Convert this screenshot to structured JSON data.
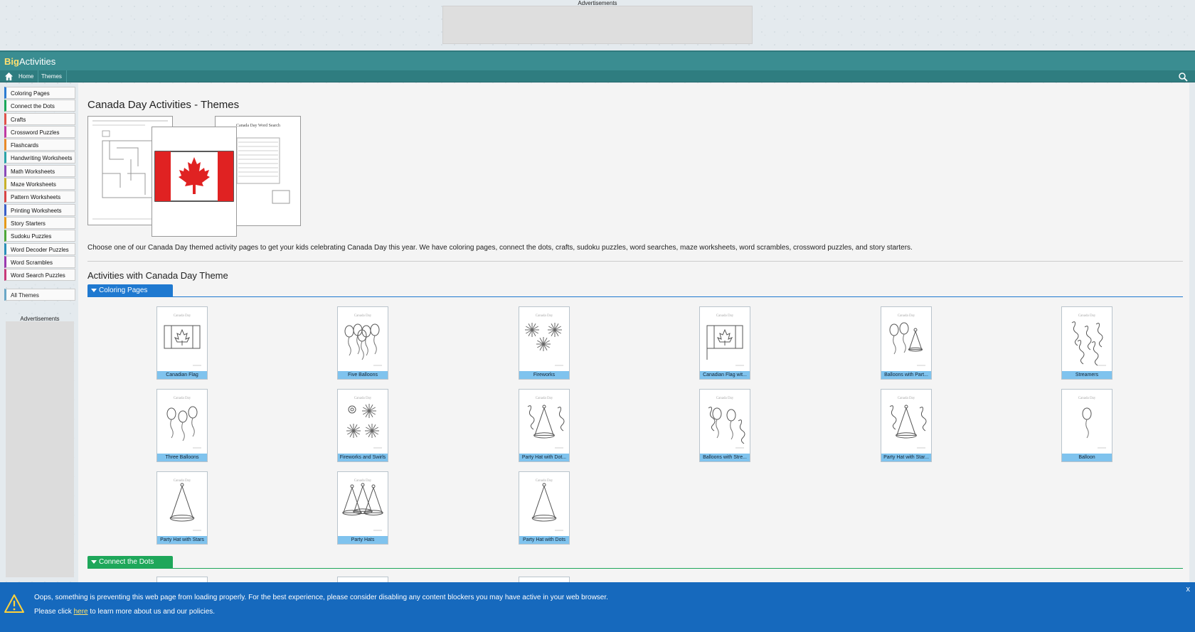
{
  "top_ad": {
    "label": "Advertisements"
  },
  "header": {
    "logo_big": "Big",
    "logo_rest": "Activities"
  },
  "nav": {
    "home": "Home",
    "themes": "Themes"
  },
  "sidebar": {
    "items": [
      {
        "label": "Coloring Pages",
        "color": "#2b7bd1"
      },
      {
        "label": "Connect the Dots",
        "color": "#1aa85a"
      },
      {
        "label": "Crafts",
        "color": "#e0524a"
      },
      {
        "label": "Crossword Puzzles",
        "color": "#c03aa3"
      },
      {
        "label": "Flashcards",
        "color": "#e88a2a"
      },
      {
        "label": "Handwriting Worksheets",
        "color": "#2aa4a8"
      },
      {
        "label": "Math Worksheets",
        "color": "#8a4ab8"
      },
      {
        "label": "Maze Worksheets",
        "color": "#c8b12a"
      },
      {
        "label": "Pattern Worksheets",
        "color": "#d84545"
      },
      {
        "label": "Printing Worksheets",
        "color": "#3a5fc8"
      },
      {
        "label": "Story Starters",
        "color": "#e59a1a"
      },
      {
        "label": "Sudoku Puzzles",
        "color": "#4fa83a"
      },
      {
        "label": "Word Decoder Puzzles",
        "color": "#2a8fb8"
      },
      {
        "label": "Word Scrambles",
        "color": "#9a3ab0"
      },
      {
        "label": "Word Search Puzzles",
        "color": "#c83a7a"
      }
    ],
    "all_themes": "All Themes",
    "ad_label": "Advertisements"
  },
  "main": {
    "title": "Canada Day Activities - Themes",
    "intro": "Choose one of our Canada Day themed activity pages to get your kids celebrating Canada Day this year. We have coloring pages, connect the dots, crafts, sudoku puzzles, word searches, maze worksheets, word scrambles, crossword puzzles, and story starters.",
    "section_title": "Activities with Canada Day Theme",
    "categories": [
      {
        "label": "Coloring Pages",
        "color": "#1f79d0",
        "items": [
          "Canadian Flag",
          "Five Balloons",
          "Fireworks",
          "Canadian Flag wit...",
          "Balloons with Part...",
          "Streamers",
          "Three Balloons",
          "Fireworks and Swirls",
          "Party Hat with Dot...",
          "Balloons with Stre...",
          "Party Hat with Star...",
          "Balloon",
          "Party Hat with Stars",
          "Party Hats",
          "Party Hat with Dots"
        ]
      },
      {
        "label": "Connect the Dots",
        "color": "#1ea75a"
      }
    ]
  },
  "notice": {
    "line1": "Oops, something is preventing this web page from loading properly. For the best experience, please consider disabling any content blockers you may have active in your web browser.",
    "line2_pre": "Please click ",
    "line2_link": "here",
    "line2_post": " to learn more about us and our policies.",
    "close": "x"
  }
}
